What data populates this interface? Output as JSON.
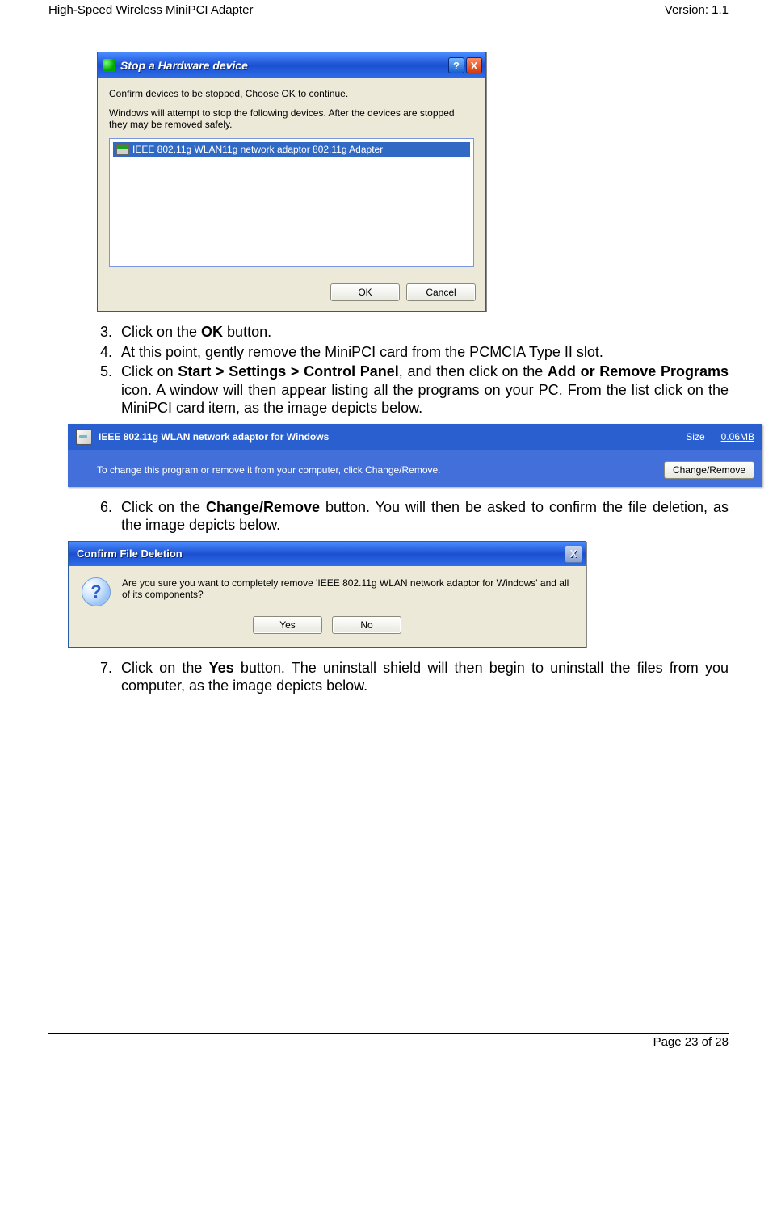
{
  "header": {
    "left": "High-Speed Wireless MiniPCI Adapter",
    "right": "Version: 1.1"
  },
  "footer": "Page 23 of 28",
  "dlg1": {
    "title": "Stop a Hardware device",
    "line1": "Confirm devices to be stopped, Choose OK to continue.",
    "line2": "Windows will attempt to stop the following devices. After the devices are stopped they may be removed safely.",
    "item": "IEEE 802.11g WLAN11g network adaptor 802.11g Adapter",
    "ok": "OK",
    "cancel": "Cancel"
  },
  "steps": {
    "s3a": "Click on the ",
    "s3b": "OK",
    "s3c": " button.",
    "s4": "At this point, gently remove the MiniPCI card from the PCMCIA Type II slot.",
    "s5a": "Click on ",
    "s5b": "Start > Settings > Control Panel",
    "s5c": ", and then click on the ",
    "s5d": "Add or Remove Programs",
    "s5e": " icon. A window will then appear listing all the programs on your PC. From the list click on the MiniPCI card item, as the image depicts below.",
    "s6a": "Click on the ",
    "s6b": "Change/Remove",
    "s6c": " button.  You will then be asked to confirm the file deletion, as the image depicts below.",
    "s7a": "Click on the ",
    "s7b": "Yes",
    "s7c": " button. The uninstall shield will then begin to uninstall the files from you computer, as the image depicts below."
  },
  "arp": {
    "name": "IEEE 802.11g WLAN network adaptor for Windows",
    "sizelbl": "Size",
    "sizeval": "0.06MB",
    "desc": "To change this program or remove it from your computer, click Change/Remove.",
    "btn": "Change/Remove"
  },
  "dlg3": {
    "title": "Confirm File Deletion",
    "msg": "Are you sure you want to completely remove 'IEEE 802.11g WLAN network adaptor for Windows' and all of its components?",
    "yes": "Yes",
    "no": "No"
  }
}
